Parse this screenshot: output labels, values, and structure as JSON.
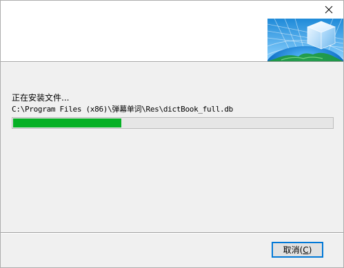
{
  "window": {
    "close_glyph": "✕"
  },
  "icons": {
    "close": "close-icon",
    "banner": "installer-globe-cube-icon"
  },
  "progress": {
    "status": "正在安装文件...",
    "current_file": "C:\\Program Files (x86)\\弹幕单词\\Res\\dictBook_full.db",
    "percent": 34
  },
  "buttons": {
    "cancel_label": "取消(",
    "cancel_mnemonic": "C",
    "cancel_suffix": ")"
  },
  "colors": {
    "progress_fill": "#06b025",
    "button_focus_border": "#0078d7"
  }
}
